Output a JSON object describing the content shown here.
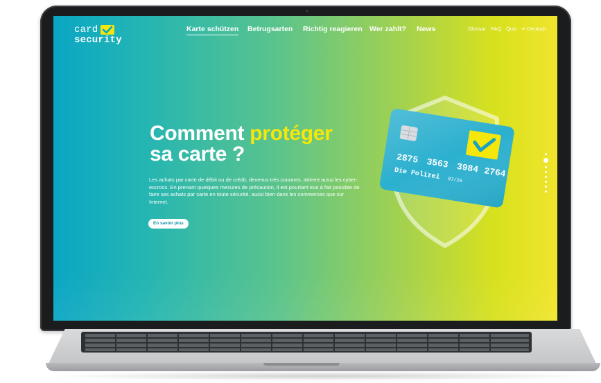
{
  "brand": {
    "logo_top": "card",
    "logo_bottom": "security",
    "accent_color": "#f5e60b",
    "primary_color": "#0aa6c4"
  },
  "nav": {
    "items": [
      {
        "label": "Karte schützen",
        "active": true
      },
      {
        "label": "Betrugsarten",
        "active": false
      },
      {
        "label": "Richtig reagieren",
        "active": false
      },
      {
        "label": "Wer zahlt?",
        "active": false
      },
      {
        "label": "News",
        "active": false
      }
    ]
  },
  "utility": {
    "glossar": "Glossar",
    "faq": "FAQ",
    "quiz": "Quiz",
    "language": "Deutsch",
    "language_icon": "chevron-down-icon"
  },
  "hero": {
    "title_part1": "Comment ",
    "title_accent": "protéger",
    "title_part2": "sa carte ?",
    "body": "Les achats par carte de débit ou de crédit, devenus très courants, attirent aussi les cyber-escrocs. En prenant quelques mesures de précaution, il est pourtant tout à fait possible de faire ses achats par carte en toute sécurité, aussi bien dans les commerces que sur Internet.",
    "cta_label": "En savoir plus"
  },
  "card_illustration": {
    "number_groups": [
      "2875",
      "3563",
      "3984",
      "2764"
    ],
    "holder": "Die Polizei",
    "expiry": "07/26",
    "icons": [
      "shield-icon",
      "chip-icon",
      "checkmark-icon"
    ]
  },
  "pager": {
    "count": 8,
    "active_index": 1
  }
}
